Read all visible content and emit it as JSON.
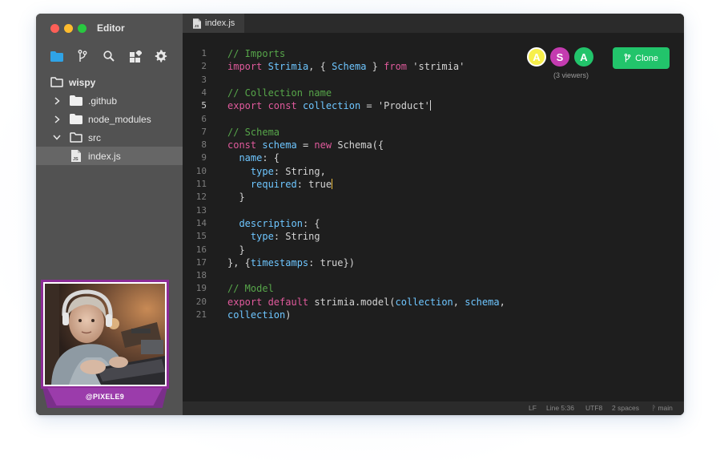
{
  "app": {
    "title": "Editor"
  },
  "sidebar": {
    "toolbar_icons": [
      "folder-icon",
      "git-branch-icon",
      "search-icon",
      "extensions-icon",
      "gear-icon"
    ],
    "tree": [
      {
        "label": "wispy",
        "type": "root-folder"
      },
      {
        "label": ".github",
        "type": "folder",
        "expanded": false
      },
      {
        "label": "node_modules",
        "type": "folder",
        "expanded": false
      },
      {
        "label": "src",
        "type": "folder",
        "expanded": true
      },
      {
        "label": "index.js",
        "type": "file",
        "selected": true
      }
    ]
  },
  "webcam": {
    "handle": "@PIXELE9"
  },
  "tabs": [
    {
      "label": "index.js",
      "active": true
    }
  ],
  "code": {
    "active_line": 5,
    "line_numbers": [
      "1",
      "2",
      "3",
      "4",
      "5",
      "6",
      "7",
      "8",
      "9",
      "10",
      "11",
      "12",
      "13",
      "14",
      "15",
      "16",
      "17",
      "18",
      "19",
      "20",
      "21"
    ],
    "lines": [
      "// Imports",
      "import Strimia, { Schema } from 'strimia'",
      "",
      "// Collection name",
      "export const collection = 'Product'",
      "",
      "// Schema",
      "const schema = new Schema({",
      "  name: {",
      "    type: String,",
      "    required: true",
      "  }",
      "",
      "  description: {",
      "    type: String",
      "  }",
      "}, {timestamps: true})",
      "",
      "// Model",
      "export default strimia.model(collection, schema,",
      "collection)"
    ]
  },
  "collaborators": {
    "avatars": [
      {
        "initial": "A",
        "color": "#f7ef4a",
        "ring": "#ffffff",
        "text_color": "#ffffff"
      },
      {
        "initial": "S",
        "color": "#c43bb0",
        "ring": "#c43bb0",
        "text_color": "#ffffff"
      },
      {
        "initial": "A",
        "color": "#22c46b",
        "ring": "#22c46b",
        "text_color": "#ffffff"
      }
    ],
    "viewers_text": "(3 viewers)"
  },
  "clone_button": {
    "label": "Clone"
  },
  "status_bar": {
    "line_ending": "LF",
    "position": "Line 5:36",
    "encoding": "UTF8",
    "indent": "2 spaces",
    "branch": "main"
  },
  "colors": {
    "accent": "#22c46b",
    "folder_icon_active": "#2fa3e6",
    "comment": "#57a64a",
    "keyword": "#e05a9c",
    "identifier": "#6ec6ff"
  }
}
